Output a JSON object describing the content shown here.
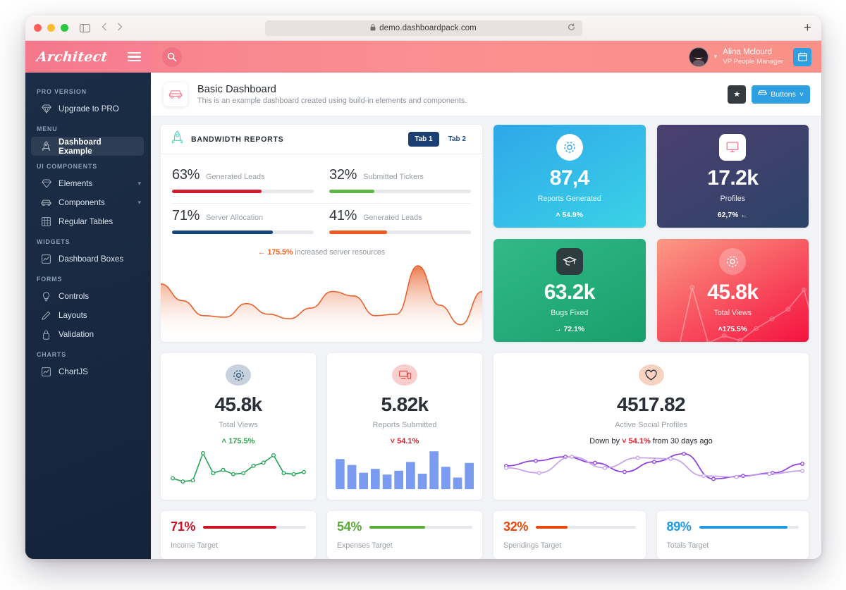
{
  "browser": {
    "url": "demo.dashboardpack.com",
    "lock_icon": "lock-icon",
    "reload_icon": "reload-icon",
    "new_tab_icon": "plus-icon"
  },
  "sidebar": {
    "logo": "Architect",
    "groups": [
      {
        "heading": "PRO VERSION",
        "items": [
          {
            "label": "Upgrade to PRO",
            "icon": "diamond-icon",
            "active": false,
            "chevron": false
          }
        ]
      },
      {
        "heading": "MENU",
        "items": [
          {
            "label": "Dashboard Example",
            "icon": "rocket-icon",
            "active": true,
            "chevron": false
          }
        ]
      },
      {
        "heading": "UI COMPONENTS",
        "items": [
          {
            "label": "Elements",
            "icon": "diamond-icon",
            "active": false,
            "chevron": true
          },
          {
            "label": "Components",
            "icon": "car-icon",
            "active": false,
            "chevron": true
          },
          {
            "label": "Regular Tables",
            "icon": "table-icon",
            "active": false,
            "chevron": false
          }
        ]
      },
      {
        "heading": "WIDGETS",
        "items": [
          {
            "label": "Dashboard Boxes",
            "icon": "chart-icon",
            "active": false,
            "chevron": false
          }
        ]
      },
      {
        "heading": "FORMS",
        "items": [
          {
            "label": "Controls",
            "icon": "bulb-icon",
            "active": false,
            "chevron": false
          },
          {
            "label": "Layouts",
            "icon": "pencil-icon",
            "active": false,
            "chevron": false
          },
          {
            "label": "Validation",
            "icon": "lock-icon",
            "active": false,
            "chevron": false
          }
        ]
      },
      {
        "heading": "CHARTS",
        "items": [
          {
            "label": "ChartJS",
            "icon": "chart-icon",
            "active": false,
            "chevron": false
          }
        ]
      }
    ]
  },
  "topbar": {
    "search_icon": "search-icon",
    "user_name": "Alina Mclourd",
    "user_role": "VP People Manager",
    "calendar_icon": "calendar-icon"
  },
  "page_header": {
    "icon": "car-icon",
    "title": "Basic Dashboard",
    "subtitle": "This is an example dashboard created using build-in elements and components.",
    "star_label": "★",
    "buttons_label": "Buttons",
    "buttons_caret": "˅"
  },
  "bandwidth": {
    "icon": "rocket-icon",
    "title": "BANDWIDTH REPORTS",
    "tabs": [
      {
        "label": "Tab 1",
        "active": true
      },
      {
        "label": "Tab 2",
        "active": false
      }
    ],
    "progress": [
      {
        "pct": "63%",
        "value": 63,
        "label": "Generated Leads",
        "color": "#d0202f"
      },
      {
        "pct": "32%",
        "value": 32,
        "label": "Submitted Tickers",
        "color": "#62b649"
      },
      {
        "pct": "71%",
        "value": 71,
        "label": "Server Allocation",
        "color": "#17457e"
      },
      {
        "pct": "41%",
        "value": 41,
        "label": "Generated Leads",
        "color": "#ef5a22"
      }
    ],
    "note_arrow": "←",
    "note_value": "175.5%",
    "note_text": "increased server resources"
  },
  "tiles": [
    {
      "value": "87,4",
      "label": "Reports Generated",
      "delta": "˄ 54.9%",
      "icon": "gear-icon",
      "icon_style": "circle",
      "icon_color": "#2fa8e8",
      "grad_from": "#2ea7e9",
      "grad_to": "#3ad2e6",
      "spark": false
    },
    {
      "value": "17.2k",
      "label": "Profiles",
      "delta": "62,7% ←",
      "icon": "monitor-icon",
      "icon_style": "sq",
      "icon_color": "#f4768a",
      "grad_from": "#4c4070",
      "grad_to": "#2c4367",
      "spark": false
    },
    {
      "value": "63.2k",
      "label": "Bugs Fixed",
      "delta": "→ 72.1%",
      "icon": "graduation-icon",
      "icon_style": "sqd",
      "icon_color": "#ffffff",
      "grad_from": "#31b98a",
      "grad_to": "#17a06b",
      "spark": false
    },
    {
      "value": "45.8k",
      "label": "Total Views",
      "delta": "˄175.5%",
      "icon": "gear-icon",
      "icon_style": "circle-t",
      "icon_color": "#ffffff",
      "grad_from": "#fb9a85",
      "grad_to": "#f5123f",
      "spark": true
    }
  ],
  "minis": [
    {
      "value": "45.8k",
      "label": "Total Views",
      "delta": "˄ 175.5%",
      "delta_color": "#30a14e",
      "icon": "gear-icon",
      "icon_bg": "#c8d2de",
      "icon_color": "#34597f"
    },
    {
      "value": "5.82k",
      "label": "Reports Submitted",
      "delta": "˅ 54.1%",
      "delta_color": "#d0202f",
      "icon": "devices-icon",
      "icon_bg": "#f9cfcd",
      "icon_color": "#e2504f"
    }
  ],
  "social": {
    "icon": "heart-icon",
    "icon_bg": "#f9d3c2",
    "icon_color": "#23282f",
    "value": "4517.82",
    "label": "Active Social Profiles",
    "note_prefix": "Down by",
    "note_value": "˅ 54.1%",
    "note_suffix": "from 30 days ago",
    "note_color": "#e0212f"
  },
  "targets": [
    {
      "pct": "71%",
      "value": 71,
      "label": "Income Target",
      "color": "#cc1122"
    },
    {
      "pct": "54%",
      "value": 54,
      "label": "Expenses Target",
      "color": "#5aaa38"
    },
    {
      "pct": "32%",
      "value": 32,
      "label": "Spendings Target",
      "color": "#e8480d"
    },
    {
      "pct": "89%",
      "value": 89,
      "label": "Totals Target",
      "color": "#219ae0"
    }
  ],
  "chart_data": [
    {
      "type": "area",
      "title": "Bandwidth / server resources",
      "x": [
        0,
        1,
        2,
        3,
        4,
        5,
        6,
        7,
        8,
        9,
        10,
        11,
        12,
        13,
        14
      ],
      "values": [
        72,
        50,
        30,
        28,
        46,
        32,
        26,
        40,
        62,
        56,
        30,
        32,
        96,
        44,
        18,
        62
      ],
      "ylim": [
        0,
        100
      ],
      "grid": false,
      "legend": false,
      "color": "#e8622d",
      "fill": "gradient orange to white"
    },
    {
      "type": "line",
      "title": "Total Views",
      "values": [
        14,
        8,
        10,
        62,
        24,
        30,
        22,
        24,
        38,
        44,
        58,
        24,
        22,
        26
      ],
      "ylim": [
        0,
        70
      ],
      "grid": false,
      "legend": false,
      "color": "#23a455",
      "markers": true
    },
    {
      "type": "bar",
      "title": "Reports Submitted",
      "categories": [
        "1",
        "2",
        "3",
        "4",
        "5",
        "6",
        "7",
        "8",
        "9",
        "10",
        "11",
        "12"
      ],
      "values": [
        62,
        50,
        34,
        42,
        30,
        38,
        56,
        32,
        78,
        46,
        24,
        54
      ],
      "ylim": [
        0,
        90
      ],
      "grid": false,
      "legend": false,
      "color": "#7b9bf0"
    },
    {
      "type": "line",
      "title": "Active Social Profiles",
      "x": [
        0,
        1,
        2,
        3,
        4,
        5,
        6,
        7,
        8,
        9,
        10
      ],
      "series": [
        {
          "name": "series-dark",
          "color": "#8d3ce0",
          "values": [
            38,
            48,
            56,
            44,
            26,
            46,
            62,
            12,
            18,
            24,
            42
          ]
        },
        {
          "name": "series-light",
          "color": "#c4a0ee",
          "values": [
            34,
            24,
            56,
            34,
            54,
            52,
            18,
            16,
            22,
            28
          ]
        }
      ],
      "ylim": [
        0,
        70
      ],
      "grid": false,
      "legend": false,
      "markers": true
    }
  ]
}
